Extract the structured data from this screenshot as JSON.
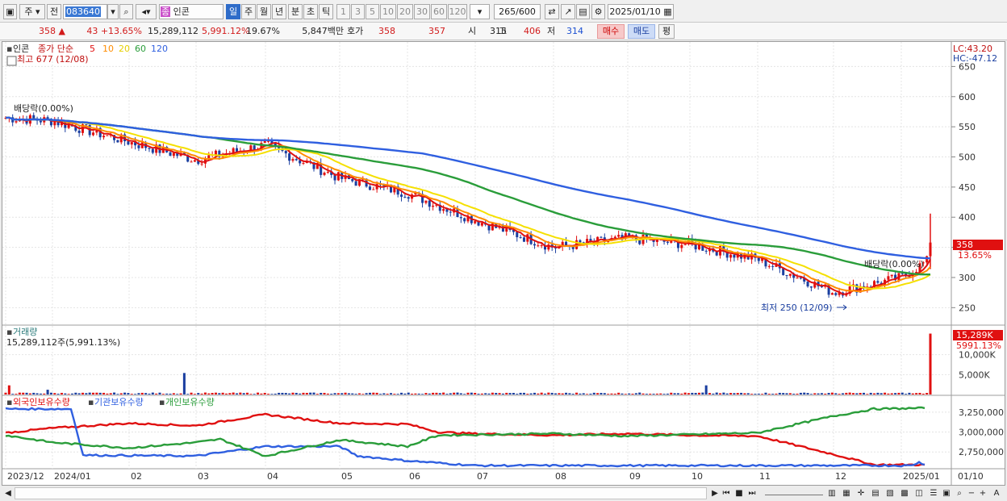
{
  "toolbar": {
    "market_label": "주",
    "prev_label": "전",
    "stock_code": "083640",
    "stock_name": "인콘",
    "stock_tag": "종",
    "periods": [
      "일",
      "주",
      "월",
      "년",
      "분",
      "초",
      "틱"
    ],
    "active_period": "일",
    "intervals": [
      "1",
      "3",
      "5",
      "10",
      "20",
      "30",
      "60",
      "120"
    ],
    "count_value": "265",
    "count_total": "/600",
    "date_value": "2025/01/10"
  },
  "infobar": {
    "price": "358",
    "change_arrow": "▲",
    "change": "43",
    "change_pct": "+13.65%",
    "volume": "15,289,112",
    "volume_ratio": "5,991.12%",
    "turnover": "19.67%",
    "amount": "5,847백만",
    "quote_label": "호가",
    "ask": "358",
    "bid": "357",
    "open_label": "시",
    "open": "315",
    "high_label": "고",
    "high": "406",
    "low_label": "저",
    "low": "314",
    "buy_label": "매수",
    "sell_label": "매도",
    "avg_label": "평"
  },
  "price_panel": {
    "name": "인콘",
    "legend_prefix": "종가 단순",
    "ma_labels": [
      "5",
      "10",
      "20",
      "60",
      "120"
    ],
    "ma_colors": [
      "#e01010",
      "#ff8c00",
      "#f5e000",
      "#2a9d3a",
      "#2f5fe0"
    ],
    "high_marker": "최고 677 (12/08)",
    "low_marker": "최저 250 (12/09)",
    "dividend_label_1": "배당락(0.00%)",
    "dividend_label_2": "배당락(0.00%)",
    "lc_label": "LC:43.20",
    "hc_label": "HC:-47.12",
    "current_price_tag": "358",
    "current_pct_tag": "13.65%"
  },
  "volume_panel": {
    "title": "거래량",
    "summary": "15,289,112주(5,991.13%)",
    "current_tag": "15,289K",
    "current_pct_tag": "5991.13%"
  },
  "holding_panel": {
    "labels": [
      "외국인보유수량",
      "기관보유수량",
      "개인보유수량"
    ],
    "colors": [
      "#e01010",
      "#2f5fe0",
      "#2a9d3a"
    ]
  },
  "x_axis_labels": [
    "2023/12",
    "2024/01",
    "02",
    "03",
    "04",
    "05",
    "06",
    "07",
    "08",
    "09",
    "10",
    "11",
    "12",
    "2025/01",
    "01/10"
  ],
  "chart_data": [
    {
      "type": "candlestick",
      "title": "인콘",
      "y_ticks": [
        250,
        300,
        350,
        400,
        450,
        500,
        550,
        600,
        650
      ],
      "ylim": [
        225,
        680
      ],
      "x_range": [
        "2023/12",
        "2025/01/10"
      ],
      "close_series_approx": [
        {
          "x": "2023/12",
          "close": 565
        },
        {
          "x": "2024/01",
          "close": 560
        },
        {
          "x": "02",
          "close": 525
        },
        {
          "x": "03",
          "close": 495
        },
        {
          "x": "04",
          "close": 520
        },
        {
          "x": "05",
          "close": 465
        },
        {
          "x": "06",
          "close": 440
        },
        {
          "x": "07",
          "close": 395
        },
        {
          "x": "08",
          "close": 350
        },
        {
          "x": "09",
          "close": 365
        },
        {
          "x": "10",
          "close": 355
        },
        {
          "x": "11",
          "close": 330
        },
        {
          "x": "12",
          "close": 275
        },
        {
          "x": "2025/01",
          "close": 300
        },
        {
          "x": "01/10",
          "close": 358
        }
      ],
      "series": [
        {
          "name": "5",
          "color": "#e01010"
        },
        {
          "name": "10",
          "color": "#ff8c00"
        },
        {
          "name": "20",
          "color": "#f5e000"
        },
        {
          "name": "60",
          "color": "#2a9d3a"
        },
        {
          "name": "120",
          "color": "#2f5fe0"
        }
      ],
      "annotations": [
        "최고 677 (12/08)",
        "최저 250 (12/09)",
        "배당락(0.00%)"
      ]
    },
    {
      "type": "bar",
      "title": "거래량",
      "y_ticks": [
        "5,000K",
        "10,000K"
      ],
      "last_value": 15289112
    },
    {
      "type": "line",
      "series_names": [
        "외국인보유수량",
        "기관보유수량",
        "개인보유수량"
      ],
      "y_ticks": [
        "2,750,000",
        "3,000,000",
        "3,250,000"
      ]
    }
  ]
}
